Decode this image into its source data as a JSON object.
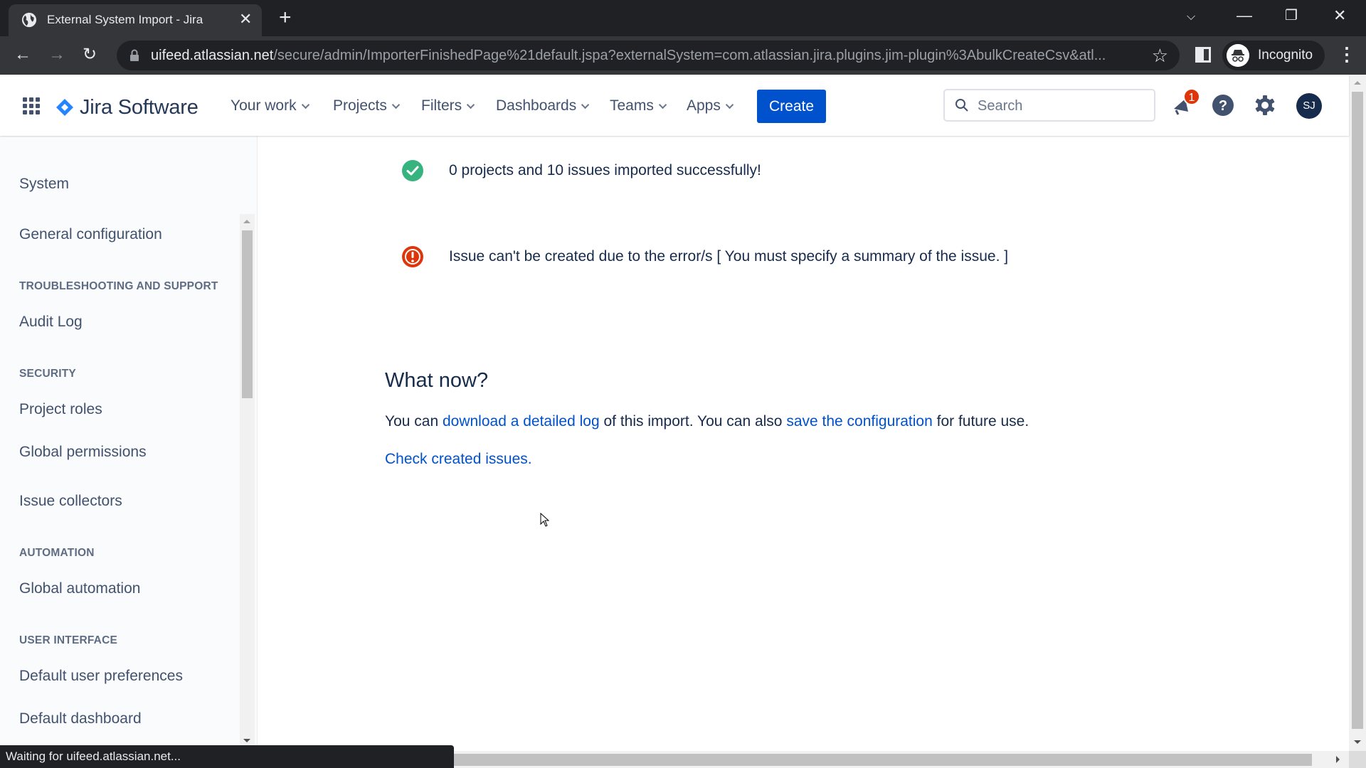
{
  "browser": {
    "tab_title": "External System Import - Jira",
    "url_host": "uifeed.atlassian.net",
    "url_path": "/secure/admin/ImporterFinishedPage%21default.jspa?externalSystem=com.atlassian.jira.plugins.jim-plugin%3AbulkCreateCsv&atl...",
    "profile_label": "Incognito",
    "status_text": "Waiting for uifeed.atlassian.net..."
  },
  "header": {
    "product_name": "Jira Software",
    "nav": [
      {
        "label": "Your work"
      },
      {
        "label": "Projects"
      },
      {
        "label": "Filters"
      },
      {
        "label": "Dashboards"
      },
      {
        "label": "Teams"
      },
      {
        "label": "Apps"
      }
    ],
    "create_label": "Create",
    "search_placeholder": "Search",
    "notification_count": "1",
    "avatar_initials": "SJ",
    "colors": {
      "brand": "#0052cc",
      "badge": "#de350b",
      "avatar": "#172b4d"
    }
  },
  "sidebar": {
    "title": "System",
    "items": [
      {
        "type": "link",
        "label": "General configuration"
      },
      {
        "type": "heading",
        "label": "TROUBLESHOOTING AND SUPPORT"
      },
      {
        "type": "link",
        "label": "Audit Log"
      },
      {
        "type": "heading",
        "label": "SECURITY"
      },
      {
        "type": "link",
        "label": "Project roles"
      },
      {
        "type": "link",
        "label": "Global permissions"
      },
      {
        "type": "link",
        "label": "Issue collectors"
      },
      {
        "type": "heading",
        "label": "AUTOMATION"
      },
      {
        "type": "link",
        "label": "Global automation"
      },
      {
        "type": "heading",
        "label": "USER INTERFACE"
      },
      {
        "type": "link",
        "label": "Default user preferences"
      },
      {
        "type": "link",
        "label": "Default dashboard"
      }
    ]
  },
  "main": {
    "success_message": "0 projects and 10 issues imported successfully!",
    "error_message": "Issue can't be created due to the error/s [ You must specify a summary of the issue. ]",
    "what_now_heading": "What now?",
    "para_prefix": "You can ",
    "download_log_link": "download a detailed log",
    "para_middle": " of this import. You can also ",
    "save_config_link": "save the configuration",
    "para_suffix": " for future use.",
    "check_issues_link": "Check created issues.",
    "colors": {
      "success": "#36b37e",
      "error": "#de350b",
      "link": "#0052cc"
    }
  }
}
